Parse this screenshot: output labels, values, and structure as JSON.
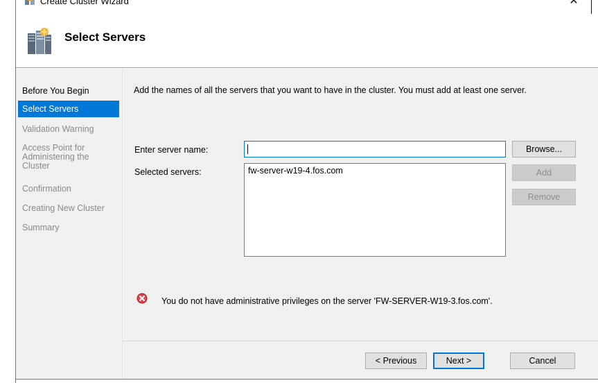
{
  "window": {
    "title": "Create Cluster Wizard",
    "close_label": "✕"
  },
  "header": {
    "title": "Select Servers",
    "icon": "cluster-servers-icon"
  },
  "nav": {
    "items": [
      {
        "label": "Before You Begin",
        "state": "done"
      },
      {
        "label": "Select Servers",
        "state": "active"
      },
      {
        "label": "Validation Warning",
        "state": "pending"
      },
      {
        "label": "Access Point for Administering the Cluster",
        "state": "pending"
      },
      {
        "label": "Confirmation",
        "state": "pending"
      },
      {
        "label": "Creating New Cluster",
        "state": "pending"
      },
      {
        "label": "Summary",
        "state": "pending"
      }
    ]
  },
  "main": {
    "instruction": "Add the names of all the servers that you want to have in the cluster. You must add at least one server.",
    "server_name_label": "Enter server name:",
    "server_name_value": "",
    "selected_servers_label": "Selected servers:",
    "selected_servers": [
      "fw-server-w19-4.fos.com"
    ],
    "browse_label": "Browse...",
    "add_label": "Add",
    "remove_label": "Remove",
    "error_icon": "error-icon",
    "error_message": "You do not have administrative privileges on the server 'FW-SERVER-W19-3.fos.com'."
  },
  "footer": {
    "previous_label": "< Previous",
    "next_label": "Next >",
    "cancel_label": "Cancel"
  },
  "colors": {
    "accent": "#0078d7",
    "panel_background": "#f0f0f0",
    "error": "#d9363e"
  }
}
